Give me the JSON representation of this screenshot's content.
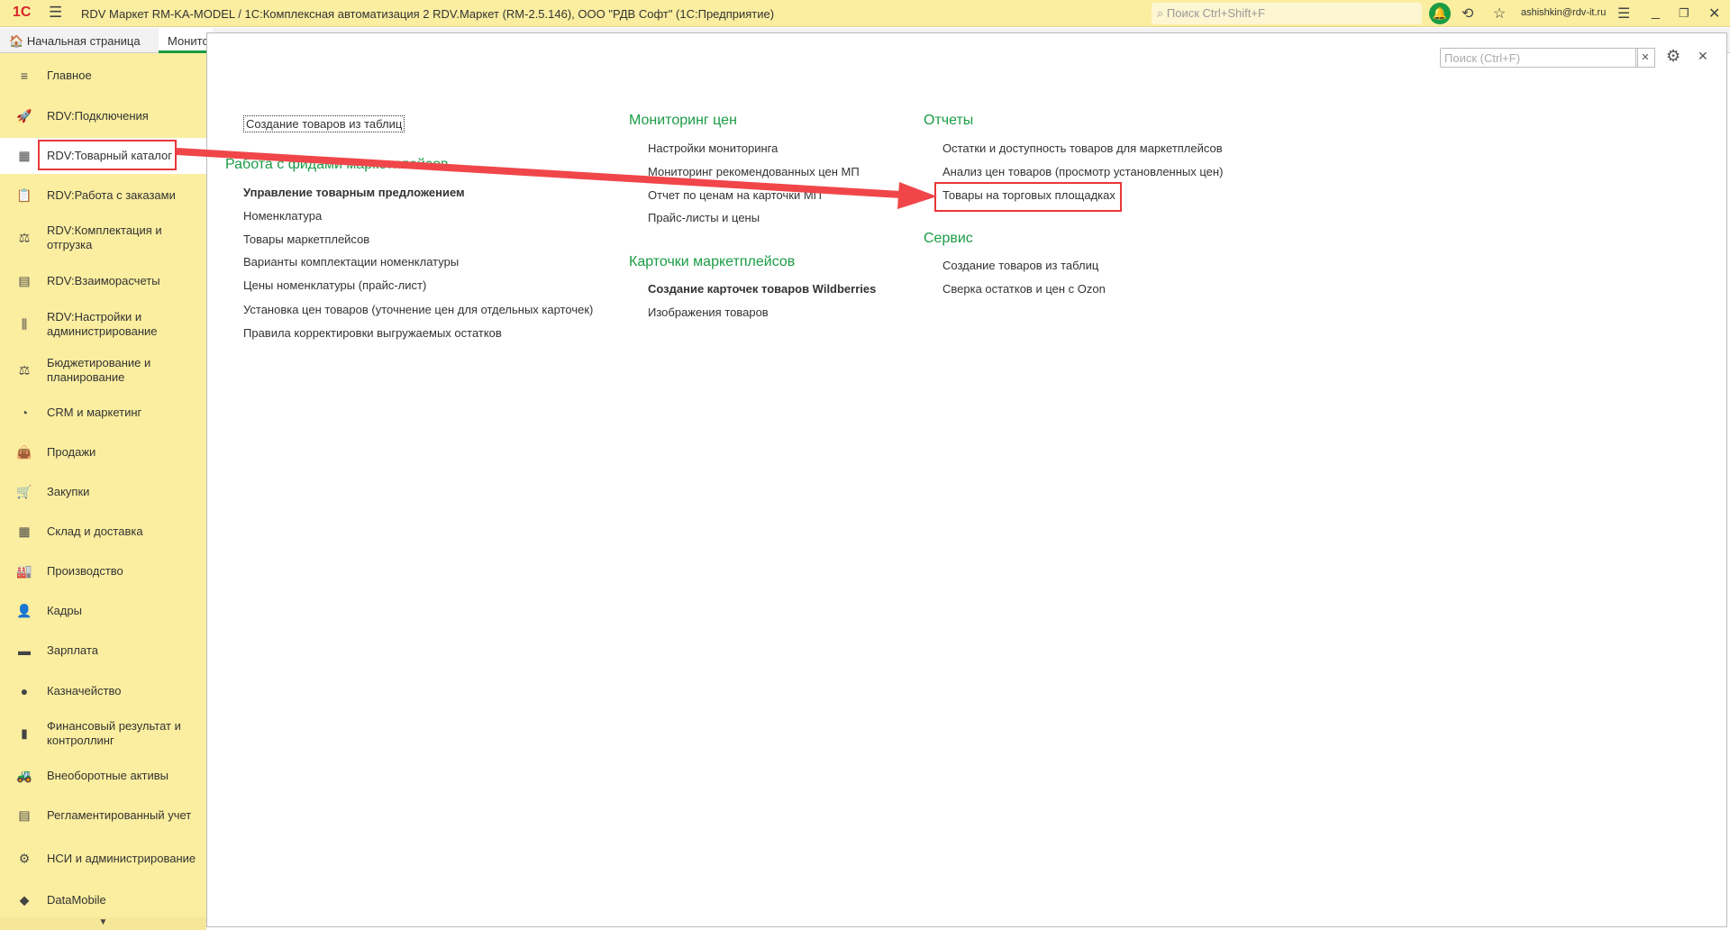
{
  "topbar": {
    "logo": "1С",
    "title": "RDV Маркет RM-KA-MODEL / 1С:Комплексная автоматизация 2 RDV.Маркет (RM-2.5.146), ООО \"РДВ Софт\"  (1С:Предприятие)",
    "search_placeholder": "Поиск Ctrl+Shift+F",
    "user": "ashishkin@rdv-it.ru"
  },
  "tabs": {
    "home": "Начальная страница",
    "current": "Монитор"
  },
  "sidebar": {
    "items": [
      {
        "label": "Главное",
        "icon": "≡"
      },
      {
        "label": "RDV:Подключения",
        "icon": "🚀"
      },
      {
        "label": "RDV:Товарный каталог",
        "icon": "▦"
      },
      {
        "label": "RDV:Работа с заказами",
        "icon": "📋"
      },
      {
        "label": "RDV:Комплектация и отгрузка",
        "icon": "⚖"
      },
      {
        "label": "RDV:Взаиморасчеты",
        "icon": "▤"
      },
      {
        "label": "RDV:Настройки и администрирование",
        "icon": "⫼"
      },
      {
        "label": "Бюджетирование и планирование",
        "icon": "⚖"
      },
      {
        "label": "CRM и маркетинг",
        "icon": "◔"
      },
      {
        "label": "Продажи",
        "icon": "👜"
      },
      {
        "label": "Закупки",
        "icon": "🛒"
      },
      {
        "label": "Склад и доставка",
        "icon": "▦"
      },
      {
        "label": "Производство",
        "icon": "🏭"
      },
      {
        "label": "Кадры",
        "icon": "👤"
      },
      {
        "label": "Зарплата",
        "icon": "▬"
      },
      {
        "label": "Казначейство",
        "icon": "●"
      },
      {
        "label": "Финансовый результат и контроллинг",
        "icon": "▮"
      },
      {
        "label": "Внеоборотные активы",
        "icon": "🚜"
      },
      {
        "label": "Регламентированный учет",
        "icon": "▤"
      },
      {
        "label": "НСИ и администрирование",
        "icon": "⚙"
      },
      {
        "label": "DataMobile",
        "icon": "◆"
      }
    ]
  },
  "panel": {
    "search_placeholder": "Поиск (Ctrl+F)"
  },
  "col1": {
    "top_link": "Создание товаров из таблиц",
    "heading": "Работа с фидами маркетплейсов",
    "items": [
      "Управление товарным предложением",
      "Номенклатура",
      "Товары маркетплейсов",
      "Варианты комплектации номенклатуры",
      "Цены номенклатуры (прайс-лист)",
      "Установка цен товаров (уточнение цен для отдельных карточек)",
      "Правила корректировки выгружаемых остатков"
    ]
  },
  "col2": {
    "heading1": "Мониторинг цен",
    "items1": [
      "Настройки мониторинга",
      "Мониторинг рекомендованных цен МП",
      "Отчет по ценам на карточки МП",
      "Прайс-листы и цены"
    ],
    "heading2": "Карточки маркетплейсов",
    "items2": [
      "Создание карточек товаров Wildberries",
      "Изображения товаров"
    ]
  },
  "col3": {
    "heading1": "Отчеты",
    "items1": [
      "Остатки и доступность товаров для маркетплейсов",
      "Анализ цен товаров (просмотр установленных цен)",
      "Товары на торговых площадках"
    ],
    "heading2": "Сервис",
    "items2": [
      "Создание товаров из таблиц",
      "Сверка остатков и цен с Ozon"
    ]
  }
}
